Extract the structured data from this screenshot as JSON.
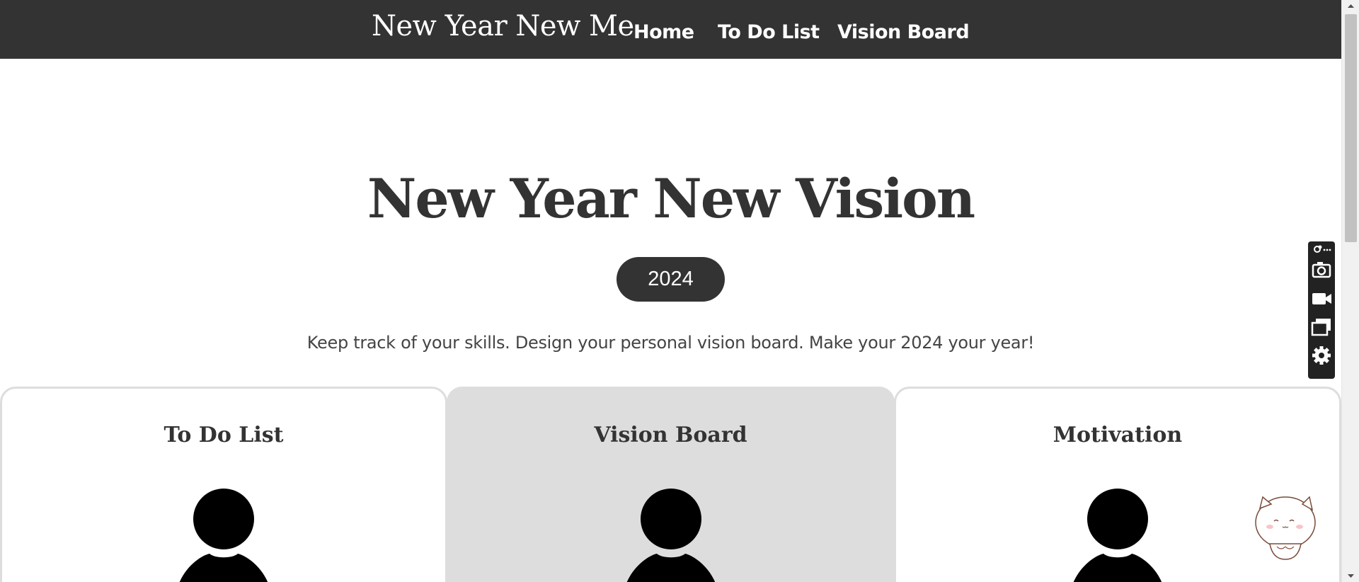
{
  "navbar": {
    "brand": "New Year New Me",
    "links": [
      "Home",
      "To Do List",
      "Vision Board"
    ]
  },
  "hero": {
    "title": "New Year New Vision",
    "year": "2024",
    "tagline": "Keep track of your skills. Design your personal vision board. Make your 2024 your year!"
  },
  "cards": [
    {
      "title": "To Do List",
      "icon": "person-icon"
    },
    {
      "title": "Vision Board",
      "icon": "person-icon",
      "active": true
    },
    {
      "title": "Motivation",
      "icon": "person-icon"
    }
  ],
  "capture_toolbar": {
    "icons": [
      "extension-menu-icon",
      "camera-icon",
      "video-camera-icon",
      "windows-icon",
      "gear-icon"
    ]
  },
  "colors": {
    "navbar": "#333333",
    "text_dark": "#333333",
    "card_active": "#dddddd",
    "card_border": "#dddddd"
  }
}
